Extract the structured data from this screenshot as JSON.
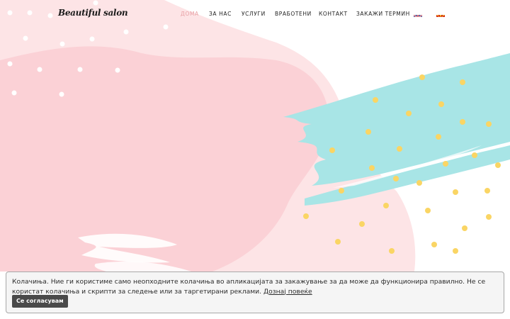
{
  "brand": {
    "name": "Beautiful salon"
  },
  "nav": {
    "items": [
      {
        "label": "ДОМА",
        "active": true
      },
      {
        "label": "ЗА НАС",
        "active": false
      },
      {
        "label": "УСЛУГИ",
        "active": false
      },
      {
        "label": "ВРАБОТЕНИ",
        "active": false
      },
      {
        "label": "КОНТАКТ",
        "active": false
      },
      {
        "label": "ЗАКАЖИ ТЕРМИН",
        "active": false
      }
    ],
    "languages": [
      {
        "icon": "uk-flag-icon"
      },
      {
        "icon": "macedonia-flag-icon"
      }
    ]
  },
  "cookie": {
    "message": "Колачиња. Ние ги користиме само неопходните колачиња во апликацијата за закажување за да може да функционира правилно. Не се користат колачиња и скрипти за следење или за таргетирани реклами.",
    "link_label": "Дознај повеќе",
    "accept_label": "Се согласувам"
  },
  "colors": {
    "pink_light": "#fde4e6",
    "pink": "#fbd1d6",
    "teal": "#a8e5e6",
    "yellow_dot": "#fad564",
    "nav_active": "#e8a0a4",
    "button_bg": "#4a4a4a"
  }
}
